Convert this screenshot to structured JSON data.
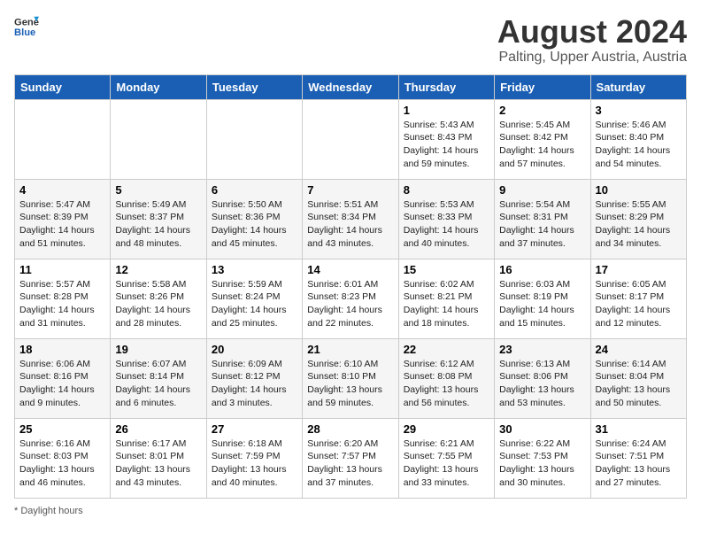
{
  "header": {
    "logo_line1": "General",
    "logo_line2": "Blue",
    "title": "August 2024",
    "subtitle": "Palting, Upper Austria, Austria"
  },
  "days_of_week": [
    "Sunday",
    "Monday",
    "Tuesday",
    "Wednesday",
    "Thursday",
    "Friday",
    "Saturday"
  ],
  "weeks": [
    [
      {
        "day": "",
        "info": ""
      },
      {
        "day": "",
        "info": ""
      },
      {
        "day": "",
        "info": ""
      },
      {
        "day": "",
        "info": ""
      },
      {
        "day": "1",
        "info": "Sunrise: 5:43 AM\nSunset: 8:43 PM\nDaylight: 14 hours\nand 59 minutes."
      },
      {
        "day": "2",
        "info": "Sunrise: 5:45 AM\nSunset: 8:42 PM\nDaylight: 14 hours\nand 57 minutes."
      },
      {
        "day": "3",
        "info": "Sunrise: 5:46 AM\nSunset: 8:40 PM\nDaylight: 14 hours\nand 54 minutes."
      }
    ],
    [
      {
        "day": "4",
        "info": "Sunrise: 5:47 AM\nSunset: 8:39 PM\nDaylight: 14 hours\nand 51 minutes."
      },
      {
        "day": "5",
        "info": "Sunrise: 5:49 AM\nSunset: 8:37 PM\nDaylight: 14 hours\nand 48 minutes."
      },
      {
        "day": "6",
        "info": "Sunrise: 5:50 AM\nSunset: 8:36 PM\nDaylight: 14 hours\nand 45 minutes."
      },
      {
        "day": "7",
        "info": "Sunrise: 5:51 AM\nSunset: 8:34 PM\nDaylight: 14 hours\nand 43 minutes."
      },
      {
        "day": "8",
        "info": "Sunrise: 5:53 AM\nSunset: 8:33 PM\nDaylight: 14 hours\nand 40 minutes."
      },
      {
        "day": "9",
        "info": "Sunrise: 5:54 AM\nSunset: 8:31 PM\nDaylight: 14 hours\nand 37 minutes."
      },
      {
        "day": "10",
        "info": "Sunrise: 5:55 AM\nSunset: 8:29 PM\nDaylight: 14 hours\nand 34 minutes."
      }
    ],
    [
      {
        "day": "11",
        "info": "Sunrise: 5:57 AM\nSunset: 8:28 PM\nDaylight: 14 hours\nand 31 minutes."
      },
      {
        "day": "12",
        "info": "Sunrise: 5:58 AM\nSunset: 8:26 PM\nDaylight: 14 hours\nand 28 minutes."
      },
      {
        "day": "13",
        "info": "Sunrise: 5:59 AM\nSunset: 8:24 PM\nDaylight: 14 hours\nand 25 minutes."
      },
      {
        "day": "14",
        "info": "Sunrise: 6:01 AM\nSunset: 8:23 PM\nDaylight: 14 hours\nand 22 minutes."
      },
      {
        "day": "15",
        "info": "Sunrise: 6:02 AM\nSunset: 8:21 PM\nDaylight: 14 hours\nand 18 minutes."
      },
      {
        "day": "16",
        "info": "Sunrise: 6:03 AM\nSunset: 8:19 PM\nDaylight: 14 hours\nand 15 minutes."
      },
      {
        "day": "17",
        "info": "Sunrise: 6:05 AM\nSunset: 8:17 PM\nDaylight: 14 hours\nand 12 minutes."
      }
    ],
    [
      {
        "day": "18",
        "info": "Sunrise: 6:06 AM\nSunset: 8:16 PM\nDaylight: 14 hours\nand 9 minutes."
      },
      {
        "day": "19",
        "info": "Sunrise: 6:07 AM\nSunset: 8:14 PM\nDaylight: 14 hours\nand 6 minutes."
      },
      {
        "day": "20",
        "info": "Sunrise: 6:09 AM\nSunset: 8:12 PM\nDaylight: 14 hours\nand 3 minutes."
      },
      {
        "day": "21",
        "info": "Sunrise: 6:10 AM\nSunset: 8:10 PM\nDaylight: 13 hours\nand 59 minutes."
      },
      {
        "day": "22",
        "info": "Sunrise: 6:12 AM\nSunset: 8:08 PM\nDaylight: 13 hours\nand 56 minutes."
      },
      {
        "day": "23",
        "info": "Sunrise: 6:13 AM\nSunset: 8:06 PM\nDaylight: 13 hours\nand 53 minutes."
      },
      {
        "day": "24",
        "info": "Sunrise: 6:14 AM\nSunset: 8:04 PM\nDaylight: 13 hours\nand 50 minutes."
      }
    ],
    [
      {
        "day": "25",
        "info": "Sunrise: 6:16 AM\nSunset: 8:03 PM\nDaylight: 13 hours\nand 46 minutes."
      },
      {
        "day": "26",
        "info": "Sunrise: 6:17 AM\nSunset: 8:01 PM\nDaylight: 13 hours\nand 43 minutes."
      },
      {
        "day": "27",
        "info": "Sunrise: 6:18 AM\nSunset: 7:59 PM\nDaylight: 13 hours\nand 40 minutes."
      },
      {
        "day": "28",
        "info": "Sunrise: 6:20 AM\nSunset: 7:57 PM\nDaylight: 13 hours\nand 37 minutes."
      },
      {
        "day": "29",
        "info": "Sunrise: 6:21 AM\nSunset: 7:55 PM\nDaylight: 13 hours\nand 33 minutes."
      },
      {
        "day": "30",
        "info": "Sunrise: 6:22 AM\nSunset: 7:53 PM\nDaylight: 13 hours\nand 30 minutes."
      },
      {
        "day": "31",
        "info": "Sunrise: 6:24 AM\nSunset: 7:51 PM\nDaylight: 13 hours\nand 27 minutes."
      }
    ]
  ],
  "footer": {
    "note": "Daylight hours"
  }
}
